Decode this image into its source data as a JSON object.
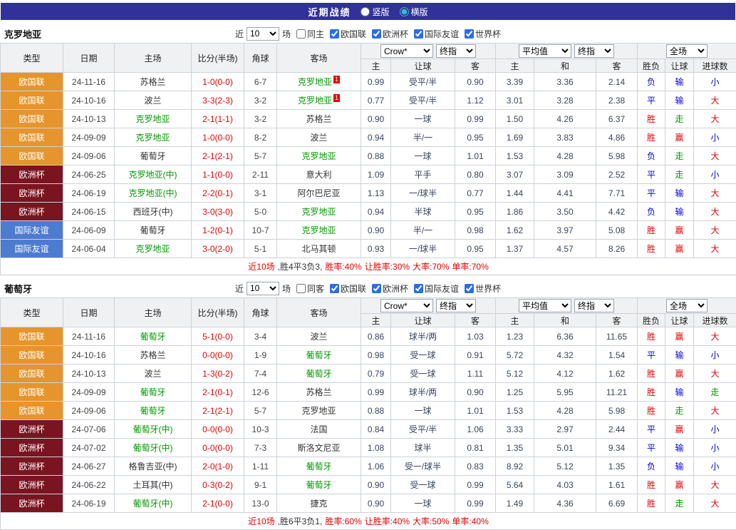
{
  "title_bar": {
    "title": "近期战绩",
    "options": [
      {
        "label": "竖版",
        "selected": false
      },
      {
        "label": "横版",
        "selected": true
      }
    ]
  },
  "colors": {
    "titlebar_bg": "#31319c",
    "border": "#ccd2da",
    "header_bg": "#f0f1f3",
    "team_self": "#009900",
    "score": "#e60000",
    "result_red": "#e60000",
    "result_blue": "#0000dd",
    "result_green": "#009900",
    "redcard_bg": "#e60000"
  },
  "type_colors": {
    "欧国联": "#e6952c",
    "欧洲杯": "#7a1420",
    "国际友谊": "#4d7bd0"
  },
  "filter": {
    "near_label": "近",
    "count": "10",
    "match_label": "场",
    "comps": [
      {
        "label": "欧国联",
        "checked": true
      },
      {
        "label": "欧洲杯",
        "checked": true
      },
      {
        "label": "国际友谊",
        "checked": true
      },
      {
        "label": "世界杯",
        "checked": true
      }
    ]
  },
  "table_header": {
    "static_cols": [
      "类型",
      "日期",
      "主场",
      "比分(半场)",
      "角球",
      "客场"
    ],
    "groups": [
      {
        "selects": [
          "Crow*",
          "终指"
        ],
        "subcols": [
          "主",
          "让球",
          "客"
        ]
      },
      {
        "selects": [
          "平均值",
          "终指"
        ],
        "subcols": [
          "主",
          "和",
          "客"
        ]
      },
      {
        "selects": [
          "全场"
        ],
        "subcols": [
          "胜负",
          "让球",
          "进球数"
        ]
      }
    ]
  },
  "sections": [
    {
      "team": "克罗地亚",
      "same_label": "同主",
      "same_checked": false,
      "rows": [
        {
          "type": "欧国联",
          "date": "24-11-16",
          "home": "苏格兰",
          "home_self": false,
          "score": "1-0(0-0)",
          "corner": "6-7",
          "away": "克罗地亚",
          "away_self": true,
          "away_card": "1",
          "odds": [
            "0.99",
            "受平/半",
            "0.90"
          ],
          "avg": [
            "3.39",
            "3.36",
            "2.14"
          ],
          "res": [
            [
              "负",
              "blue"
            ],
            [
              "输",
              "blue"
            ],
            [
              "小",
              "blue"
            ]
          ]
        },
        {
          "type": "欧国联",
          "date": "24-10-16",
          "home": "波兰",
          "home_self": false,
          "score": "3-3(2-3)",
          "corner": "3-2",
          "away": "克罗地亚",
          "away_self": true,
          "away_card": "1",
          "odds": [
            "0.77",
            "受平/半",
            "1.12"
          ],
          "avg": [
            "3.01",
            "3.28",
            "2.38"
          ],
          "res": [
            [
              "平",
              "blue"
            ],
            [
              "输",
              "blue"
            ],
            [
              "大",
              "red"
            ]
          ]
        },
        {
          "type": "欧国联",
          "date": "24-10-13",
          "home": "克罗地亚",
          "home_self": true,
          "score": "2-1(1-1)",
          "corner": "3-2",
          "away": "苏格兰",
          "away_self": false,
          "odds": [
            "0.90",
            "一球",
            "0.99"
          ],
          "avg": [
            "1.50",
            "4.26",
            "6.37"
          ],
          "res": [
            [
              "胜",
              "red"
            ],
            [
              "走",
              "green"
            ],
            [
              "大",
              "red"
            ]
          ]
        },
        {
          "type": "欧国联",
          "date": "24-09-09",
          "home": "克罗地亚",
          "home_self": true,
          "score": "1-0(0-0)",
          "corner": "8-2",
          "away": "波兰",
          "away_self": false,
          "odds": [
            "0.94",
            "半/一",
            "0.95"
          ],
          "avg": [
            "1.69",
            "3.83",
            "4.86"
          ],
          "res": [
            [
              "胜",
              "red"
            ],
            [
              "赢",
              "red"
            ],
            [
              "小",
              "blue"
            ]
          ]
        },
        {
          "type": "欧国联",
          "date": "24-09-06",
          "home": "葡萄牙",
          "home_self": false,
          "score": "2-1(2-1)",
          "corner": "5-7",
          "away": "克罗地亚",
          "away_self": true,
          "odds": [
            "0.88",
            "一球",
            "1.01"
          ],
          "avg": [
            "1.53",
            "4.28",
            "5.98"
          ],
          "res": [
            [
              "负",
              "blue"
            ],
            [
              "走",
              "green"
            ],
            [
              "大",
              "red"
            ]
          ]
        },
        {
          "type": "欧洲杯",
          "date": "24-06-25",
          "home": "克罗地亚(中)",
          "home_self": true,
          "score": "1-1(0-0)",
          "corner": "2-11",
          "away": "意大利",
          "away_self": false,
          "odds": [
            "1.09",
            "平手",
            "0.80"
          ],
          "avg": [
            "3.07",
            "3.09",
            "2.52"
          ],
          "res": [
            [
              "平",
              "blue"
            ],
            [
              "走",
              "green"
            ],
            [
              "小",
              "blue"
            ]
          ]
        },
        {
          "type": "欧洲杯",
          "date": "24-06-19",
          "home": "克罗地亚(中)",
          "home_self": true,
          "score": "2-2(0-1)",
          "corner": "3-1",
          "away": "阿尔巴尼亚",
          "away_self": false,
          "odds": [
            "1.13",
            "一/球半",
            "0.77"
          ],
          "avg": [
            "1.44",
            "4.41",
            "7.71"
          ],
          "res": [
            [
              "平",
              "blue"
            ],
            [
              "输",
              "blue"
            ],
            [
              "大",
              "red"
            ]
          ]
        },
        {
          "type": "欧洲杯",
          "date": "24-06-15",
          "home": "西班牙(中)",
          "home_self": false,
          "score": "3-0(3-0)",
          "corner": "5-0",
          "away": "克罗地亚",
          "away_self": true,
          "odds": [
            "0.94",
            "半球",
            "0.95"
          ],
          "avg": [
            "1.86",
            "3.50",
            "4.42"
          ],
          "res": [
            [
              "负",
              "blue"
            ],
            [
              "输",
              "blue"
            ],
            [
              "大",
              "red"
            ]
          ]
        },
        {
          "type": "国际友谊",
          "date": "24-06-09",
          "home": "葡萄牙",
          "home_self": false,
          "score": "1-2(0-1)",
          "corner": "10-7",
          "away": "克罗地亚",
          "away_self": true,
          "odds": [
            "0.90",
            "半/一",
            "0.98"
          ],
          "avg": [
            "1.62",
            "3.97",
            "5.08"
          ],
          "res": [
            [
              "胜",
              "red"
            ],
            [
              "赢",
              "red"
            ],
            [
              "大",
              "red"
            ]
          ]
        },
        {
          "type": "国际友谊",
          "date": "24-06-04",
          "home": "克罗地亚",
          "home_self": true,
          "score": "3-0(2-0)",
          "corner": "5-1",
          "away": "北马其顿",
          "away_self": false,
          "odds": [
            "0.93",
            "一/球半",
            "0.95"
          ],
          "avg": [
            "1.37",
            "4.57",
            "8.26"
          ],
          "res": [
            [
              "胜",
              "red"
            ],
            [
              "赢",
              "red"
            ],
            [
              "大",
              "red"
            ]
          ]
        }
      ],
      "summary": [
        [
          "近10场",
          "red"
        ],
        [
          ",胜4平3负3,",
          "dark"
        ],
        [
          "胜率:40%",
          "red"
        ],
        [
          "让胜率:30%",
          "red"
        ],
        [
          "大率:70%",
          "red"
        ],
        [
          "单率:70%",
          "red"
        ]
      ]
    },
    {
      "team": "葡萄牙",
      "same_label": "同客",
      "same_checked": false,
      "rows": [
        {
          "type": "欧国联",
          "date": "24-11-16",
          "home": "葡萄牙",
          "home_self": true,
          "score": "5-1(0-0)",
          "corner": "3-4",
          "away": "波兰",
          "away_self": false,
          "odds": [
            "0.86",
            "球半/两",
            "1.03"
          ],
          "avg": [
            "1.23",
            "6.36",
            "11.65"
          ],
          "res": [
            [
              "胜",
              "red"
            ],
            [
              "赢",
              "red"
            ],
            [
              "大",
              "red"
            ]
          ]
        },
        {
          "type": "欧国联",
          "date": "24-10-16",
          "home": "苏格兰",
          "home_self": false,
          "score": "0-0(0-0)",
          "corner": "1-9",
          "away": "葡萄牙",
          "away_self": true,
          "odds": [
            "0.98",
            "受一球",
            "0.91"
          ],
          "avg": [
            "5.72",
            "4.32",
            "1.54"
          ],
          "res": [
            [
              "平",
              "blue"
            ],
            [
              "输",
              "blue"
            ],
            [
              "小",
              "blue"
            ]
          ]
        },
        {
          "type": "欧国联",
          "date": "24-10-13",
          "home": "波兰",
          "home_self": false,
          "score": "1-3(0-2)",
          "corner": "7-4",
          "away": "葡萄牙",
          "away_self": true,
          "odds": [
            "0.79",
            "受一球",
            "1.11"
          ],
          "avg": [
            "5.12",
            "4.12",
            "1.62"
          ],
          "res": [
            [
              "胜",
              "red"
            ],
            [
              "赢",
              "red"
            ],
            [
              "大",
              "red"
            ]
          ]
        },
        {
          "type": "欧国联",
          "date": "24-09-09",
          "home": "葡萄牙",
          "home_self": true,
          "score": "2-1(0-1)",
          "corner": "12-6",
          "away": "苏格兰",
          "away_self": false,
          "odds": [
            "0.99",
            "球半/两",
            "0.90"
          ],
          "avg": [
            "1.25",
            "5.95",
            "11.21"
          ],
          "res": [
            [
              "胜",
              "red"
            ],
            [
              "输",
              "blue"
            ],
            [
              "走",
              "green"
            ]
          ]
        },
        {
          "type": "欧国联",
          "date": "24-09-06",
          "home": "葡萄牙",
          "home_self": true,
          "score": "2-1(2-1)",
          "corner": "5-7",
          "away": "克罗地亚",
          "away_self": false,
          "odds": [
            "0.88",
            "一球",
            "1.01"
          ],
          "avg": [
            "1.53",
            "4.28",
            "5.98"
          ],
          "res": [
            [
              "胜",
              "red"
            ],
            [
              "走",
              "green"
            ],
            [
              "大",
              "red"
            ]
          ]
        },
        {
          "type": "欧洲杯",
          "date": "24-07-06",
          "home": "葡萄牙(中)",
          "home_self": true,
          "score": "0-0(0-0)",
          "corner": "10-3",
          "away": "法国",
          "away_self": false,
          "odds": [
            "0.84",
            "受平/半",
            "1.06"
          ],
          "avg": [
            "3.33",
            "2.97",
            "2.44"
          ],
          "res": [
            [
              "平",
              "blue"
            ],
            [
              "赢",
              "red"
            ],
            [
              "小",
              "blue"
            ]
          ]
        },
        {
          "type": "欧洲杯",
          "date": "24-07-02",
          "home": "葡萄牙(中)",
          "home_self": true,
          "score": "0-0(0-0)",
          "corner": "7-3",
          "away": "斯洛文尼亚",
          "away_self": false,
          "odds": [
            "1.08",
            "球半",
            "0.81"
          ],
          "avg": [
            "1.35",
            "5.01",
            "9.34"
          ],
          "res": [
            [
              "平",
              "blue"
            ],
            [
              "输",
              "blue"
            ],
            [
              "小",
              "blue"
            ]
          ]
        },
        {
          "type": "欧洲杯",
          "date": "24-06-27",
          "home": "格鲁吉亚(中)",
          "home_self": false,
          "score": "2-0(1-0)",
          "corner": "1-11",
          "away": "葡萄牙",
          "away_self": true,
          "odds": [
            "1.06",
            "受一/球半",
            "0.83"
          ],
          "avg": [
            "8.92",
            "5.12",
            "1.35"
          ],
          "res": [
            [
              "负",
              "blue"
            ],
            [
              "输",
              "blue"
            ],
            [
              "小",
              "blue"
            ]
          ]
        },
        {
          "type": "欧洲杯",
          "date": "24-06-22",
          "home": "土耳其(中)",
          "home_self": false,
          "score": "0-3(0-2)",
          "corner": "9-1",
          "away": "葡萄牙",
          "away_self": true,
          "odds": [
            "0.90",
            "受一球",
            "0.99"
          ],
          "avg": [
            "5.64",
            "4.03",
            "1.61"
          ],
          "res": [
            [
              "胜",
              "red"
            ],
            [
              "赢",
              "red"
            ],
            [
              "大",
              "red"
            ]
          ]
        },
        {
          "type": "欧洲杯",
          "date": "24-06-19",
          "home": "葡萄牙(中)",
          "home_self": true,
          "score": "2-1(0-0)",
          "corner": "13-0",
          "away": "捷克",
          "away_self": false,
          "odds": [
            "0.90",
            "一球",
            "0.99"
          ],
          "avg": [
            "1.49",
            "4.36",
            "6.69"
          ],
          "res": [
            [
              "胜",
              "red"
            ],
            [
              "走",
              "green"
            ],
            [
              "大",
              "red"
            ]
          ]
        }
      ],
      "summary": [
        [
          "近10场",
          "red"
        ],
        [
          ",胜6平3负1,",
          "dark"
        ],
        [
          "胜率:60%",
          "red"
        ],
        [
          "让胜率:40%",
          "red"
        ],
        [
          "大率:50%",
          "red"
        ],
        [
          "单率:40%",
          "red"
        ]
      ]
    }
  ]
}
